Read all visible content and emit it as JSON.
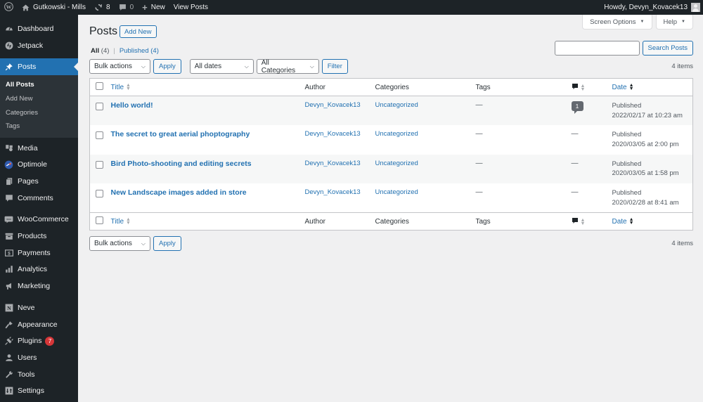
{
  "admin_bar": {
    "site_name": "Gutkowski - Mills",
    "updates_count": "8",
    "comments_count": "0",
    "new_label": "New",
    "view_posts_label": "View Posts",
    "howdy": "Howdy, Devyn_Kovacek13"
  },
  "sidebar": {
    "items": [
      {
        "label": "Dashboard",
        "icon": "dashboard-icon"
      },
      {
        "label": "Jetpack",
        "icon": "jetpack-icon"
      },
      {
        "label": "Posts",
        "icon": "pin-icon"
      },
      {
        "label": "Media",
        "icon": "media-icon"
      },
      {
        "label": "Optimole",
        "icon": "optimole-icon"
      },
      {
        "label": "Pages",
        "icon": "pages-icon"
      },
      {
        "label": "Comments",
        "icon": "comments-icon"
      },
      {
        "label": "WooCommerce",
        "icon": "woocommerce-icon"
      },
      {
        "label": "Products",
        "icon": "products-icon"
      },
      {
        "label": "Payments",
        "icon": "payments-icon"
      },
      {
        "label": "Analytics",
        "icon": "analytics-icon"
      },
      {
        "label": "Marketing",
        "icon": "megaphone-icon"
      },
      {
        "label": "Neve",
        "icon": "neve-icon"
      },
      {
        "label": "Appearance",
        "icon": "brush-icon"
      },
      {
        "label": "Plugins",
        "icon": "plug-icon",
        "badge": "7"
      },
      {
        "label": "Users",
        "icon": "user-icon"
      },
      {
        "label": "Tools",
        "icon": "wrench-icon"
      },
      {
        "label": "Settings",
        "icon": "settings-icon"
      }
    ],
    "submenu": [
      "All Posts",
      "Add New",
      "Categories",
      "Tags"
    ]
  },
  "screen_meta": {
    "screen_options": "Screen Options",
    "help": "Help"
  },
  "page": {
    "title": "Posts",
    "add_new": "Add New"
  },
  "views": {
    "all_label": "All",
    "all_count": "(4)",
    "published_label": "Published",
    "published_count": "(4)"
  },
  "search": {
    "value": "",
    "button": "Search Posts"
  },
  "tablenav": {
    "bulk_actions": "Bulk actions",
    "apply": "Apply",
    "dates": "All dates",
    "categories": "All Categories",
    "filter": "Filter",
    "items_count": "4 items"
  },
  "table": {
    "columns": {
      "title": "Title",
      "author": "Author",
      "categories": "Categories",
      "tags": "Tags",
      "date": "Date"
    },
    "rows": [
      {
        "title": "Hello world!",
        "author": "Devyn_Kovacek13",
        "categories": "Uncategorized",
        "tags": "—",
        "comments": "1",
        "status": "Published",
        "date": "2022/02/17 at 10:23 am"
      },
      {
        "title": "The secret to great aerial phoptography",
        "author": "Devyn_Kovacek13",
        "categories": "Uncategorized",
        "tags": "—",
        "comments": "—",
        "status": "Published",
        "date": "2020/03/05 at 2:00 pm"
      },
      {
        "title": "Bird Photo-shooting and editing secrets",
        "author": "Devyn_Kovacek13",
        "categories": "Uncategorized",
        "tags": "—",
        "comments": "—",
        "status": "Published",
        "date": "2020/03/05 at 1:58 pm"
      },
      {
        "title": "New Landscape images added in store",
        "author": "Devyn_Kovacek13",
        "categories": "Uncategorized",
        "tags": "—",
        "comments": "—",
        "status": "Published",
        "date": "2020/02/28 at 8:41 am"
      }
    ]
  }
}
